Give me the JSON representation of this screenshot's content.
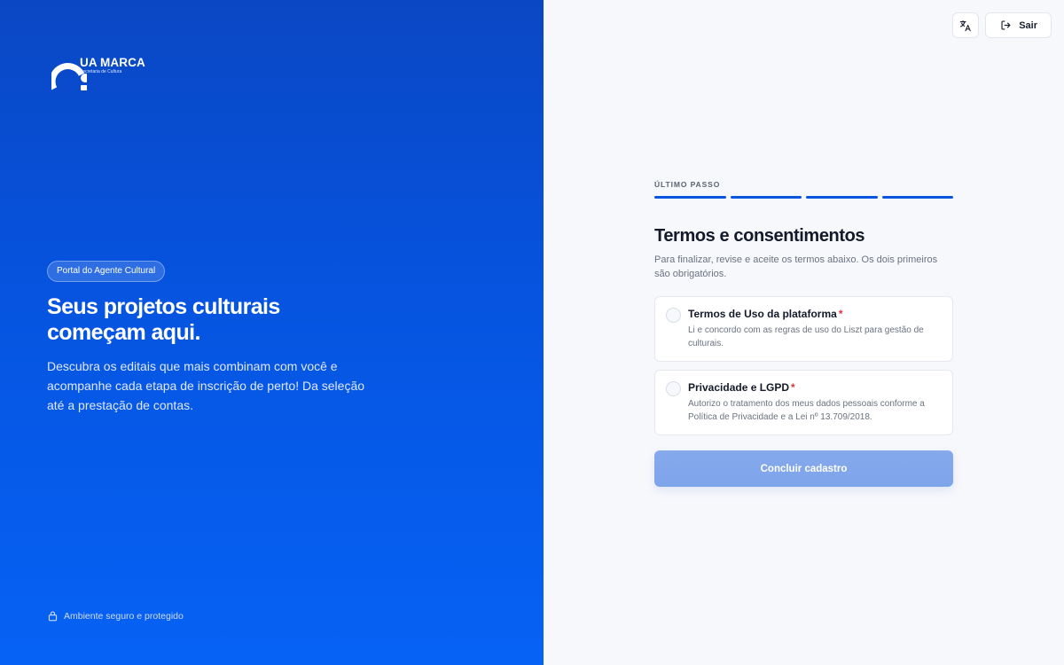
{
  "brand": {
    "name": "UA MARCA",
    "subtitle": "Secretaria de Cultura"
  },
  "hero": {
    "badge": "Portal do Agente Cultural",
    "title_line1": "Seus projetos culturais",
    "title_line2": "começam aqui.",
    "description": "Descubra os editais que mais combinam com você e acompanhe cada etapa de inscrição de perto! Da seleção até a prestação de contas.",
    "secure_note": "Ambiente seguro e protegido"
  },
  "header": {
    "translate_icon": "translate-icon",
    "exit_label": "Sair",
    "exit_icon": "logout-icon"
  },
  "form": {
    "step_label": "ÚLTIMO PASSO",
    "progress": {
      "completed_steps": 4,
      "total_steps": 4
    },
    "title": "Termos e consentimentos",
    "subtitle": "Para finalizar, revise e aceite os termos abaixo. Os dois primeiros são obrigatórios.",
    "terms": [
      {
        "title": "Termos de Uso da plataforma",
        "required_mark": "*",
        "description": "Li e concordo com as regras de uso do Liszt para gestão de culturais.",
        "checked": false
      },
      {
        "title": "Privacidade e LGPD",
        "required_mark": "*",
        "description": "Autorizo o tratamento dos meus dados pessoais conforme a Política de Privacidade e a Lei nº 13.709/2018.",
        "checked": false
      }
    ],
    "submit_label": "Concluir cadastro"
  },
  "colors": {
    "primary": "#0a55e0",
    "panel_gradient_top": "#0a47c4",
    "panel_gradient_bottom": "#0662f5",
    "required": "#e0323a",
    "submit_disabled": "#82a7eb"
  }
}
